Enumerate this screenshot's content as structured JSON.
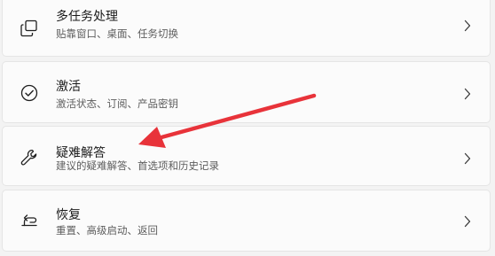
{
  "items": [
    {
      "id": "multitasking",
      "title": "多任务处理",
      "subtitle": "贴靠窗口、桌面、任务切换",
      "icon": "multitasking-icon"
    },
    {
      "id": "activation",
      "title": "激活",
      "subtitle": "激活状态、订阅、产品密钥",
      "icon": "activation-check-icon"
    },
    {
      "id": "troubleshoot",
      "title": "疑难解答",
      "subtitle": "建议的疑难解答、首选项和历史记录",
      "icon": "wrench-icon"
    },
    {
      "id": "recovery",
      "title": "恢复",
      "subtitle": "重置、高级启动、返回",
      "icon": "recovery-icon"
    }
  ],
  "chevron_icon": "chevron-right-icon",
  "annotation": {
    "type": "arrow",
    "color": "#e8333a",
    "points_to": "troubleshoot"
  }
}
